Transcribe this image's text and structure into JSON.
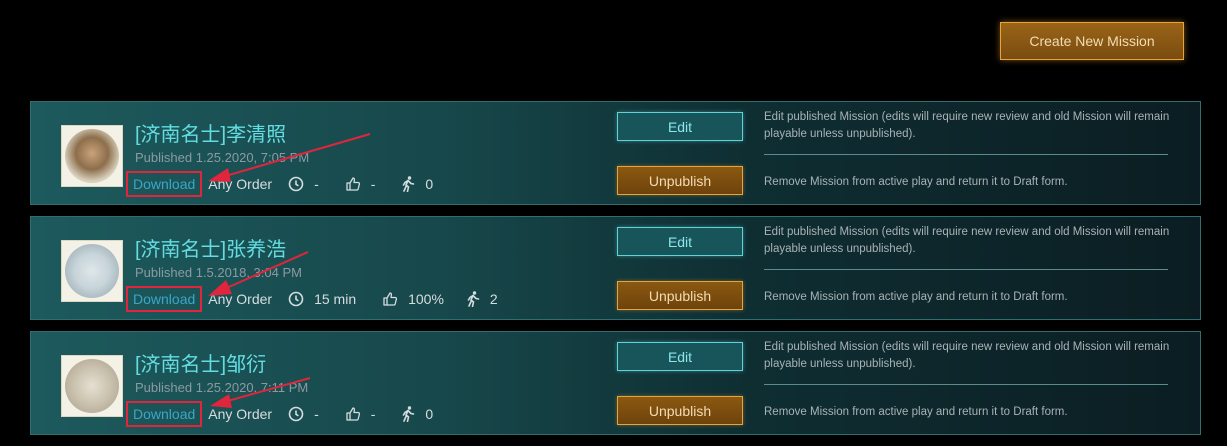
{
  "header": {
    "create_button_label": "Create New Mission"
  },
  "missions": [
    {
      "title": "[济南名士]李清照",
      "published": "Published 1.25.2020, 7:05 PM",
      "download_label": "Download",
      "order": "Any Order",
      "time": "-",
      "rating": "-",
      "players": "0",
      "edit_label": "Edit",
      "edit_desc": "Edit published Mission (edits will require new review and old Mission will remain playable unless unpublished).",
      "unpublish_label": "Unpublish",
      "unpublish_desc": "Remove Mission from active play and return it to Draft form."
    },
    {
      "title": "[济南名士]张养浩",
      "published": "Published 1.5.2018, 3:04 PM",
      "download_label": "Download",
      "order": "Any Order",
      "time": "15 min",
      "rating": "100%",
      "players": "2",
      "edit_label": "Edit",
      "edit_desc": "Edit published Mission (edits will require new review and old Mission will remain playable unless unpublished).",
      "unpublish_label": "Unpublish",
      "unpublish_desc": "Remove Mission from active play and return it to Draft form."
    },
    {
      "title": "[济南名士]邹衍",
      "published": "Published 1.25.2020, 7:11 PM",
      "download_label": "Download",
      "order": "Any Order",
      "time": "-",
      "rating": "-",
      "players": "0",
      "edit_label": "Edit",
      "edit_desc": "Edit published Mission (edits will require new review and old Mission will remain playable unless unpublished).",
      "unpublish_label": "Unpublish",
      "unpublish_desc": "Remove Mission from active play and return it to Draft form."
    }
  ],
  "icons": {
    "time": "clock-icon",
    "rating": "thumbs-up-icon",
    "players": "walking-person-icon",
    "annotation": "red-arrow-icon"
  },
  "colors": {
    "accent_teal": "#63dde1",
    "accent_orange": "#e8a33a",
    "annotation_red": "#e0253c"
  }
}
